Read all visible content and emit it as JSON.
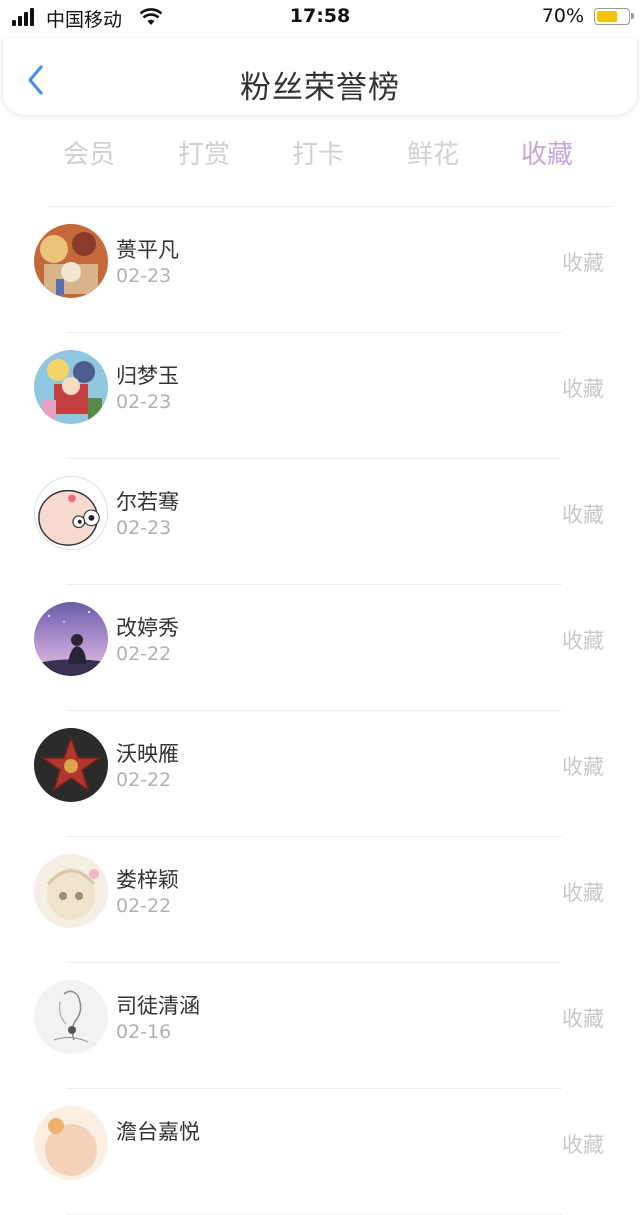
{
  "status": {
    "carrier": "中国移动",
    "time": "17:58",
    "battery": "70%",
    "battery_level": 0.7
  },
  "nav": {
    "title": "粉丝荣誉榜",
    "back_icon": "chevron-left-icon",
    "accent": "#4a90e2"
  },
  "tabs": [
    {
      "label": "会员"
    },
    {
      "label": "打赏"
    },
    {
      "label": "打卡"
    },
    {
      "label": "鲜花"
    },
    {
      "label": "收藏"
    }
  ],
  "active_tab": "收藏",
  "colors": {
    "active_tab": "#c6a6dc",
    "inactive_tab": "#d0d0d0"
  },
  "fans": [
    {
      "name": "蒉平凡",
      "date": "02-23",
      "action": "收藏",
      "avatar": "illustration-avatar"
    },
    {
      "name": "归梦玉",
      "date": "02-23",
      "action": "收藏",
      "avatar": "anime-group-avatar"
    },
    {
      "name": "尔若骞",
      "date": "02-23",
      "action": "收藏",
      "avatar": "cartoon-face-avatar"
    },
    {
      "name": "改婷秀",
      "date": "02-22",
      "action": "收藏",
      "avatar": "night-sky-avatar"
    },
    {
      "name": "沃映雁",
      "date": "02-22",
      "action": "收藏",
      "avatar": "red-star-avatar"
    },
    {
      "name": "娄梓颖",
      "date": "02-22",
      "action": "收藏",
      "avatar": "anime-girl-avatar"
    },
    {
      "name": "司徒清涵",
      "date": "02-16",
      "action": "收藏",
      "avatar": "sketch-avatar"
    },
    {
      "name": "澹台嘉悦",
      "date": "",
      "action": "收藏",
      "avatar": "partial-avatar"
    }
  ]
}
